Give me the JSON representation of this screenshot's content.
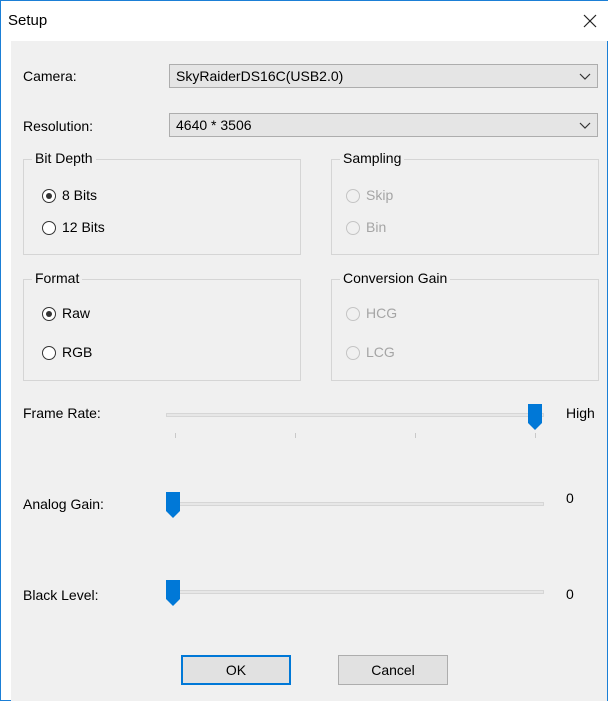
{
  "window": {
    "title": "Setup"
  },
  "camera": {
    "label": "Camera:",
    "value": "SkyRaiderDS16C(USB2.0)"
  },
  "resolution": {
    "label": "Resolution:",
    "value": "4640 * 3506"
  },
  "bit_depth": {
    "title": "Bit Depth",
    "options": [
      "8 Bits",
      "12 Bits"
    ],
    "selected": "8 Bits"
  },
  "sampling": {
    "title": "Sampling",
    "options": [
      "Skip",
      "Bin"
    ],
    "enabled": false
  },
  "format": {
    "title": "Format",
    "options": [
      "Raw",
      "RGB"
    ],
    "selected": "Raw"
  },
  "conversion_gain": {
    "title": "Conversion Gain",
    "options": [
      "HCG",
      "LCG"
    ],
    "enabled": false
  },
  "frame_rate": {
    "label": "Frame Rate:",
    "value_text": "High",
    "level": 1.0
  },
  "analog_gain": {
    "label": "Analog Gain:",
    "value_text": "0",
    "level": 0.0
  },
  "black_level": {
    "label": "Black Level:",
    "value_text": "0",
    "level": 0.0
  },
  "buttons": {
    "ok": "OK",
    "cancel": "Cancel"
  },
  "colors": {
    "accent": "#0078d7",
    "border": "#1b7fd6",
    "dialog_bg": "#f0f0f0"
  },
  "icons": {
    "close": "close-icon",
    "dropdown": "chevron-down-icon"
  }
}
